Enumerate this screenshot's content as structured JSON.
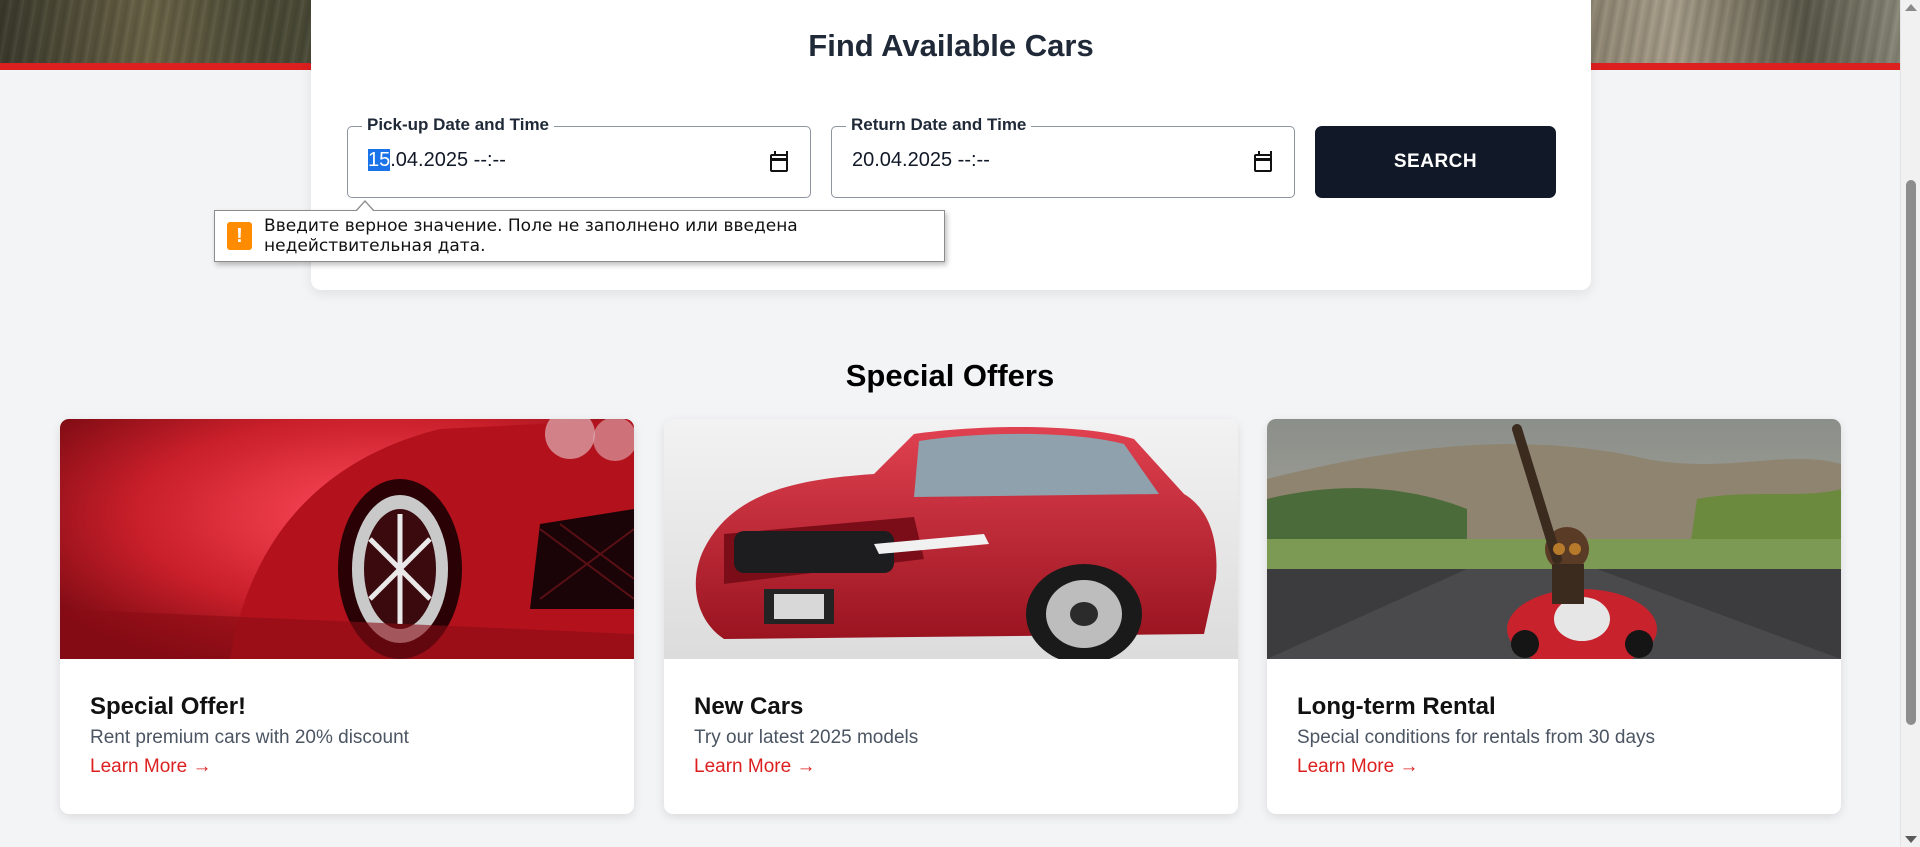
{
  "search": {
    "title": "Find Available Cars",
    "pickup": {
      "label": "Pick-up Date and Time",
      "value_selected": "15",
      "value_rest": ".04.2025 --:--"
    },
    "return": {
      "label": "Return Date and Time",
      "value": "20.04.2025 --:--"
    },
    "button_label": "SEARCH",
    "validation_message": "Введите верное значение. Поле не заполнено или введена недействительная дата."
  },
  "offers": {
    "section_title": "Special Offers",
    "items": [
      {
        "title": "Special Offer!",
        "description": "Rent premium cars with 20% discount",
        "link": "Learn More →"
      },
      {
        "title": "New Cars",
        "description": "Try our latest 2025 models",
        "link": "Learn More →"
      },
      {
        "title": "Long-term Rental",
        "description": "Special conditions for rentals from 30 days",
        "link": "Learn More →"
      }
    ]
  },
  "colors": {
    "accent": "#dc1f1f",
    "button_bg": "#111827",
    "warning": "#ff8c00",
    "page_bg": "#f3f4f6"
  },
  "icons": [
    "calendar-icon",
    "warning-icon"
  ]
}
